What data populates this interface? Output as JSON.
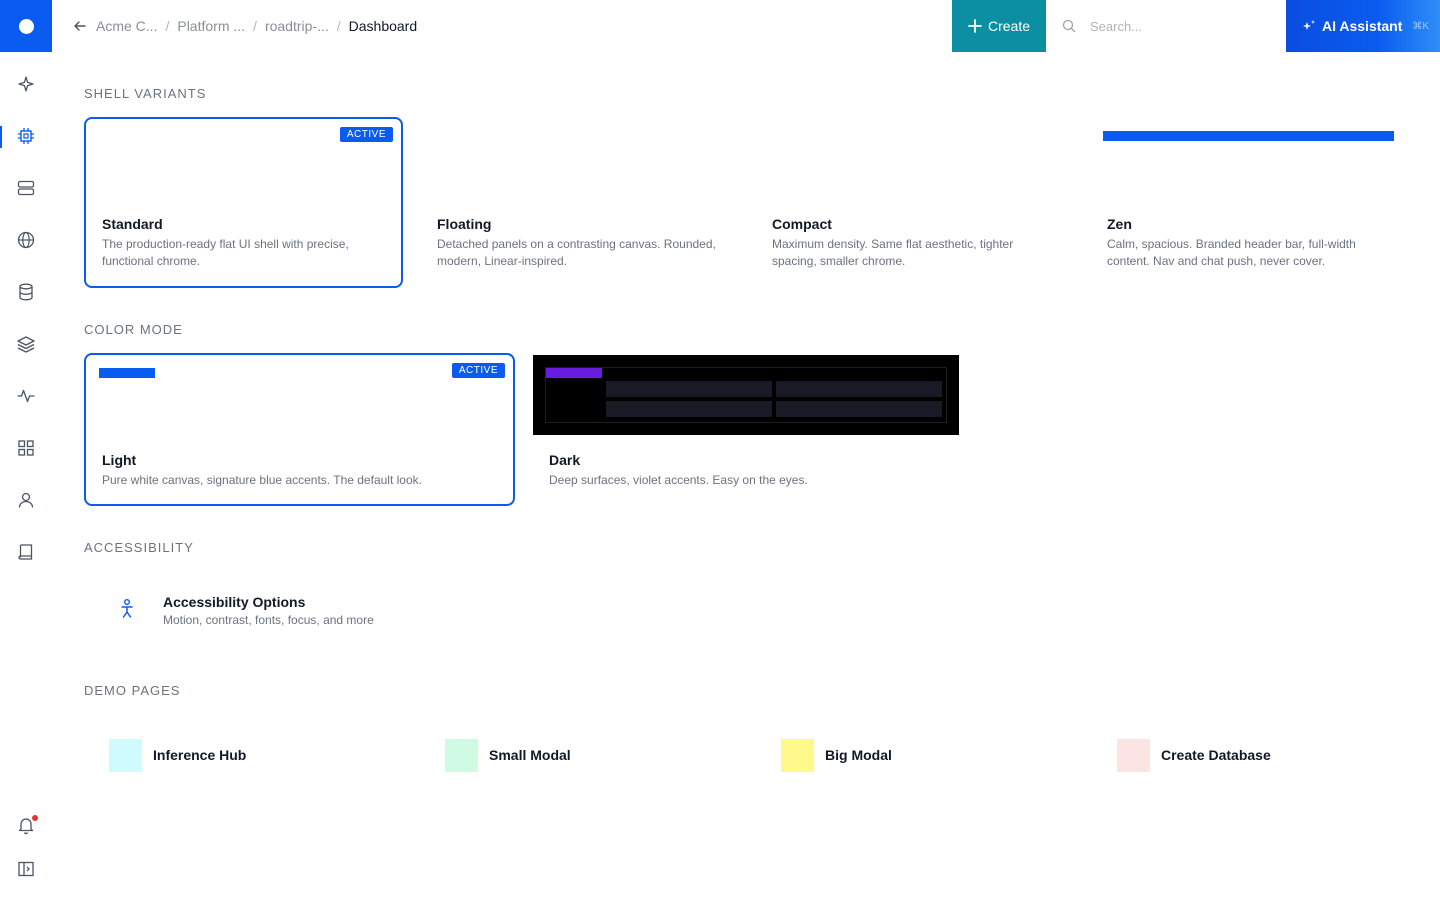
{
  "header": {
    "breadcrumbs": [
      "Acme C...",
      "Platform ...",
      "roadtrip-...",
      "Dashboard"
    ],
    "create_label": "Create",
    "search_placeholder": "Search...",
    "ai_label": "AI Assistant",
    "ai_shortcut": "⌘K"
  },
  "sidebar": {
    "items": [
      {
        "icon": "sparkle-icon",
        "active": false
      },
      {
        "icon": "chip-icon",
        "active": true
      },
      {
        "icon": "server-icon",
        "active": false
      },
      {
        "icon": "globe-icon",
        "active": false
      },
      {
        "icon": "database-icon",
        "active": false
      },
      {
        "icon": "layers-icon",
        "active": false
      },
      {
        "icon": "activity-icon",
        "active": false
      },
      {
        "icon": "grid-icon",
        "active": false
      },
      {
        "icon": "user-icon",
        "active": false
      },
      {
        "icon": "book-icon",
        "active": false
      }
    ],
    "bottom": [
      {
        "icon": "bell-icon",
        "has_notification": true
      },
      {
        "icon": "panel-toggle-icon"
      }
    ]
  },
  "shell": {
    "title": "SHELL VARIANTS",
    "active_badge": "ACTIVE",
    "variants": [
      {
        "name": "Standard",
        "desc": "The production-ready flat UI shell with precise, functional chrome.",
        "active": true
      },
      {
        "name": "Floating",
        "desc": "Detached panels on a contrasting canvas. Rounded, modern, Linear-inspired.",
        "active": false
      },
      {
        "name": "Compact",
        "desc": "Maximum density. Same flat aesthetic, tighter spacing, smaller chrome.",
        "active": false
      },
      {
        "name": "Zen",
        "desc": "Calm, spacious. Branded header bar, full-width content. Nav and chat push, never cover.",
        "active": false
      }
    ]
  },
  "color_mode": {
    "title": "COLOR MODE",
    "active_badge": "ACTIVE",
    "modes": [
      {
        "name": "Light",
        "desc": "Pure white canvas, signature blue accents. The default look.",
        "active": true
      },
      {
        "name": "Dark",
        "desc": "Deep surfaces, violet accents. Easy on the eyes.",
        "active": false
      }
    ]
  },
  "accessibility": {
    "title": "ACCESSIBILITY",
    "option_title": "Accessibility Options",
    "option_desc": "Motion, contrast, fonts, focus, and more"
  },
  "demo": {
    "title": "DEMO PAGES",
    "pages": [
      {
        "label": "Inference Hub",
        "color": "#cffafe"
      },
      {
        "label": "Small Modal",
        "color": "#d1fae5"
      },
      {
        "label": "Big Modal",
        "color": "#fef98a"
      },
      {
        "label": "Create Database",
        "color": "#fde4e4"
      }
    ]
  },
  "colors": {
    "brand_blue": "#0a5cf0",
    "create_teal": "#0d8fa3",
    "dark_violet": "#6a1be0"
  }
}
